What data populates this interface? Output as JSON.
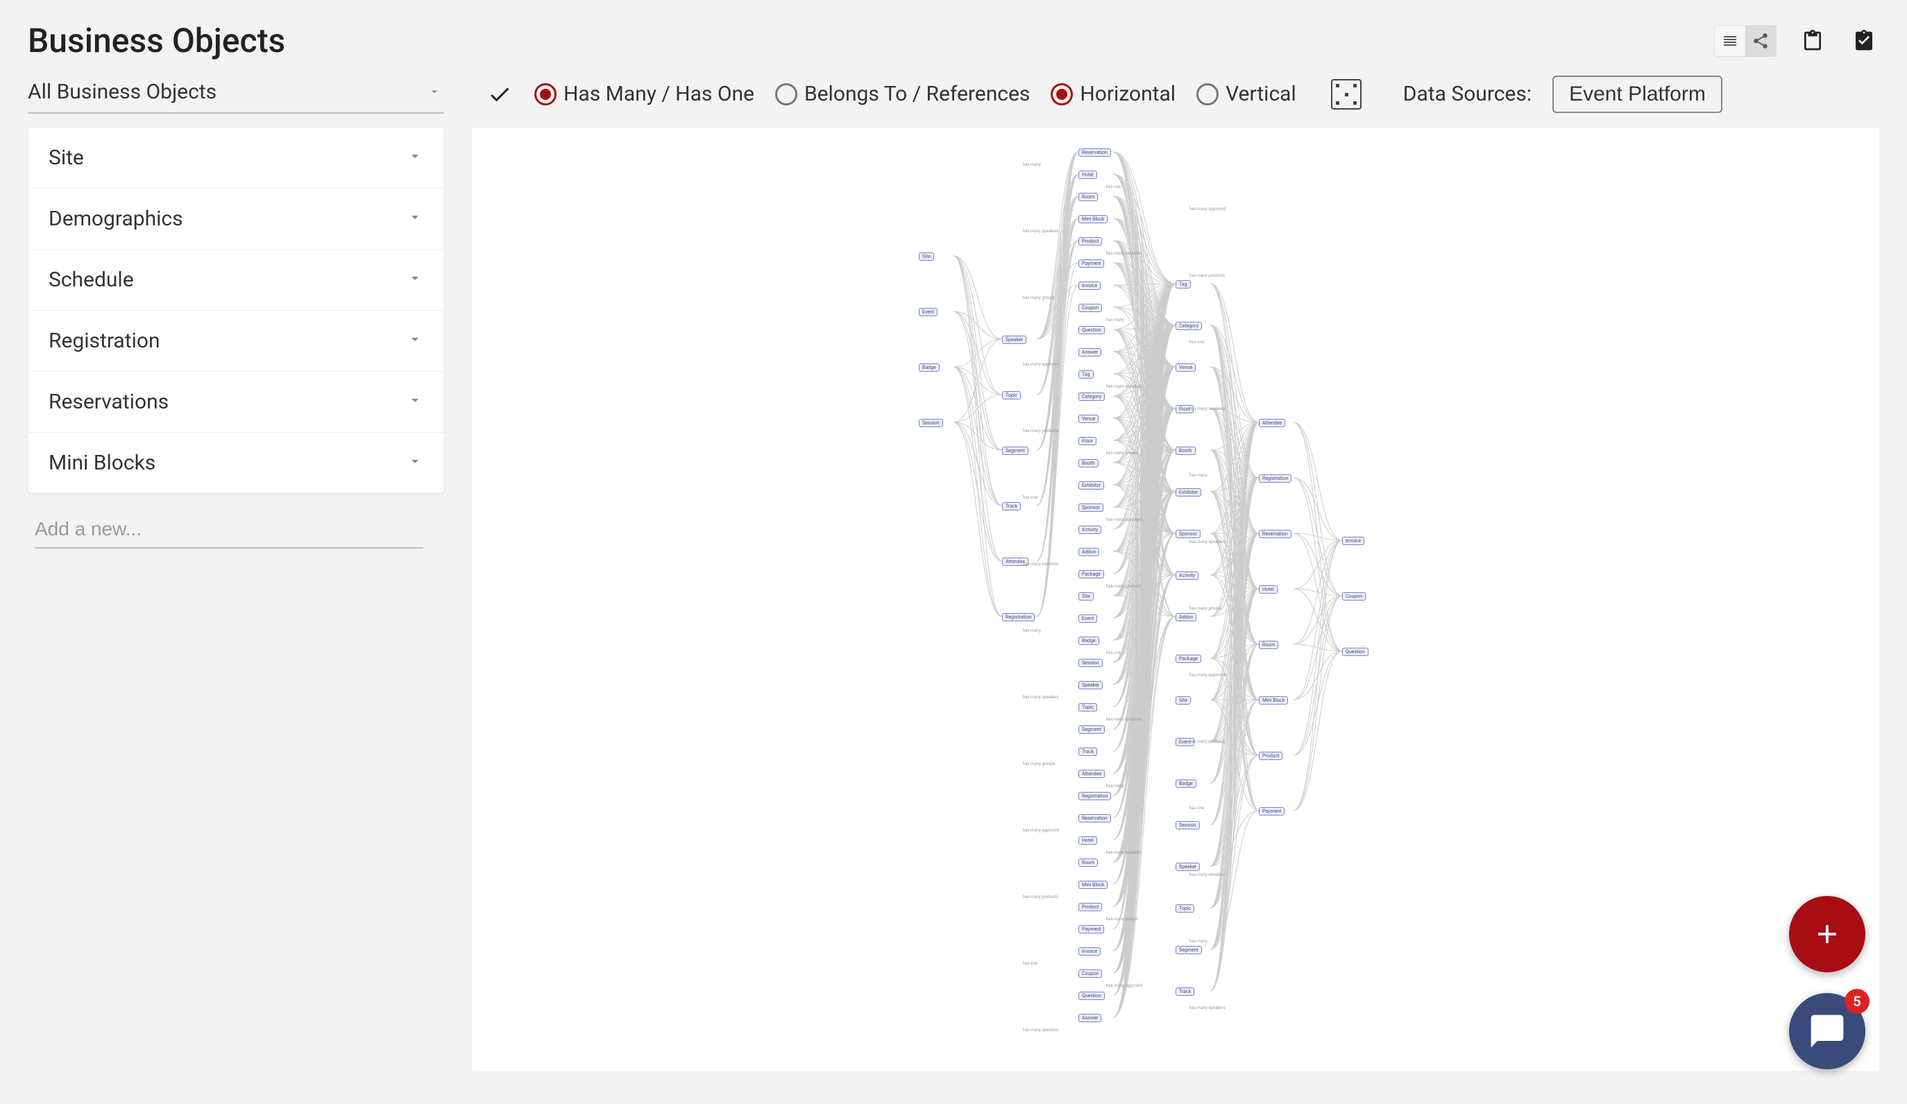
{
  "page_title": "Business Objects",
  "dropdown_value": "All Business Objects",
  "relationship_filters": {
    "has_many_label": "Has Many / Has One",
    "has_many_checked": true,
    "belongs_to_label": "Belongs To / References",
    "belongs_to_checked": false
  },
  "orientation": {
    "horizontal_label": "Horizontal",
    "horizontal_checked": true,
    "vertical_label": "Vertical",
    "vertical_checked": false
  },
  "data_sources_label": "Data Sources:",
  "data_source_button": "Event Platform",
  "sidebar_categories": [
    "Site",
    "Demographics",
    "Schedule",
    "Registration",
    "Reservations",
    "Mini Blocks"
  ],
  "add_new_placeholder": "Add a new...",
  "chat_badge_count": "5",
  "diagram_nodes_sample": [
    "Site",
    "Event",
    "Badge",
    "Session",
    "Speaker",
    "Topic",
    "Segment",
    "Track",
    "Attendee",
    "Registration",
    "Reservation",
    "Hotel",
    "Room",
    "Mini Block",
    "Product",
    "Payment",
    "Invoice",
    "Coupon",
    "Question",
    "Answer",
    "Tag",
    "Category",
    "Venue",
    "Floor",
    "Booth",
    "Exhibitor",
    "Sponsor",
    "Activity",
    "Addon",
    "Package"
  ],
  "diagram_edge_labels_sample": [
    "has many",
    "has one",
    "has many approved",
    "has many speakers",
    "has many sessions",
    "has many products",
    "has many groups"
  ]
}
